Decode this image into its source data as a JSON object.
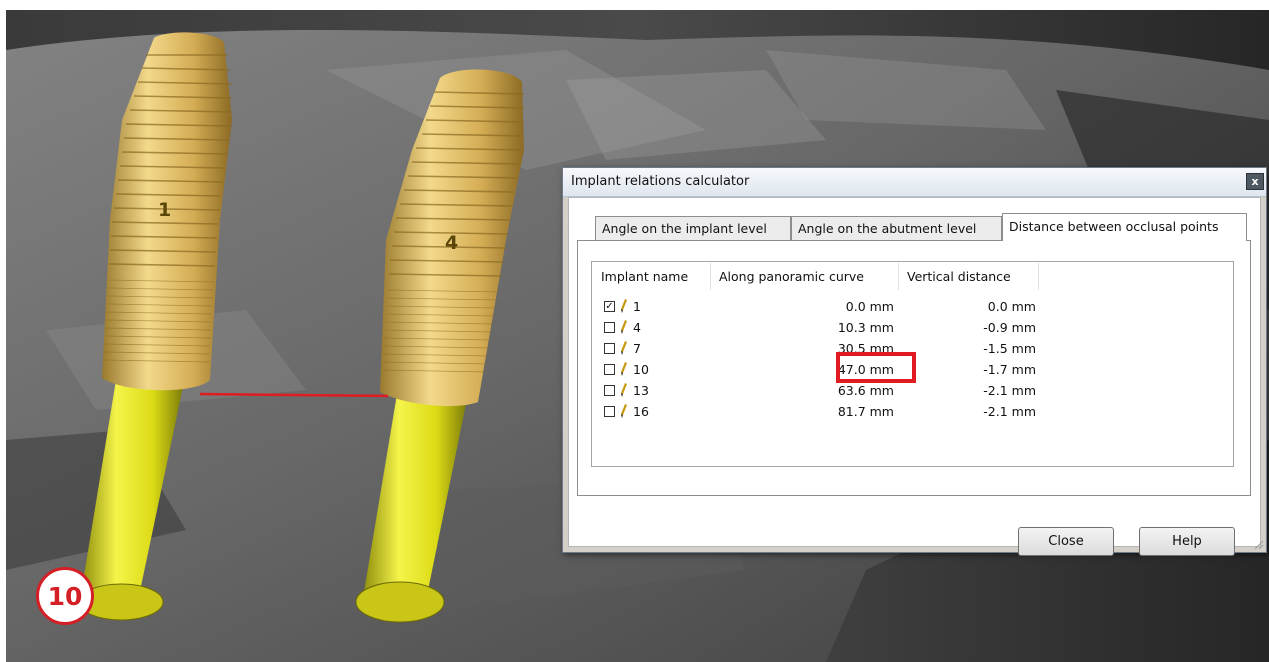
{
  "step_number": "10",
  "scene": {
    "implants": [
      {
        "label": "1"
      },
      {
        "label": "4"
      }
    ]
  },
  "dialog": {
    "title": "Implant relations calculator",
    "close_glyph": "x",
    "tabs": [
      {
        "label": "Angle on the implant level",
        "active": false
      },
      {
        "label": "Angle on the abutment level",
        "active": false
      },
      {
        "label": "Distance between occlusal points",
        "active": true
      }
    ],
    "table": {
      "columns": [
        "Implant name",
        "Along panoramic curve",
        "Vertical distance"
      ],
      "rows": [
        {
          "checked": true,
          "name": "1",
          "panoramic": "0.0 mm",
          "vertical": "0.0 mm"
        },
        {
          "checked": false,
          "name": "4",
          "panoramic": "10.3 mm",
          "vertical": "-0.9 mm"
        },
        {
          "checked": false,
          "name": "7",
          "panoramic": "30.5 mm",
          "vertical": "-1.5 mm"
        },
        {
          "checked": false,
          "name": "10",
          "panoramic": "47.0 mm",
          "vertical": "-1.7 mm"
        },
        {
          "checked": false,
          "name": "13",
          "panoramic": "63.6 mm",
          "vertical": "-2.1 mm"
        },
        {
          "checked": false,
          "name": "16",
          "panoramic": "81.7 mm",
          "vertical": "-2.1 mm"
        }
      ]
    },
    "buttons": {
      "close": "Close",
      "help": "Help"
    }
  },
  "colors": {
    "highlight": "#e01b22",
    "implant_gold": "#d9b45a",
    "abutment_yellow": "#e6e51a",
    "badge_red": "#d51f26"
  }
}
